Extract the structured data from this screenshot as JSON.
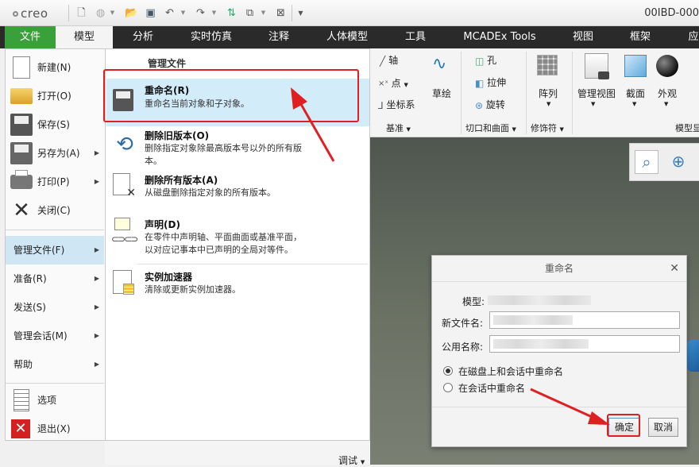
{
  "app": {
    "logo": "creo",
    "window_title": "00IBD-000"
  },
  "ribbon_tabs": [
    "文件",
    "模型",
    "分析",
    "实时仿真",
    "注释",
    "人体模型",
    "工具",
    "MCADEx Tools",
    "视图",
    "框架",
    "应"
  ],
  "ribbon": {
    "datum": {
      "axis": "轴",
      "point": "点",
      "csys": "坐标系",
      "sketch": "草绘",
      "group": "基准"
    },
    "cut_surface": {
      "hole": "孔",
      "extrude": "拉伸",
      "revolve": "旋转",
      "group": "切口和曲面"
    },
    "modifiers": {
      "pattern": "阵列",
      "group": "修饰符"
    },
    "display": {
      "manage_views": "管理视图",
      "section": "截面",
      "appearance": "外观",
      "group": "模型显"
    }
  },
  "file_menu": {
    "items": [
      {
        "label": "新建(N)",
        "icon": "new-file-icon",
        "arrow": false
      },
      {
        "label": "打开(O)",
        "icon": "open-folder-icon",
        "arrow": false
      },
      {
        "label": "保存(S)",
        "icon": "save-disk-icon",
        "arrow": false
      },
      {
        "label": "另存为(A)",
        "icon": "save-as-icon",
        "arrow": true
      },
      {
        "label": "打印(P)",
        "icon": "printer-icon",
        "arrow": true
      },
      {
        "label": "关闭(C)",
        "icon": "close-x-icon",
        "arrow": false
      }
    ],
    "text_items": [
      {
        "label": "管理文件(F)",
        "arrow": true,
        "selected": true
      },
      {
        "label": "准备(R)",
        "arrow": true
      },
      {
        "label": "发送(S)",
        "arrow": true
      },
      {
        "label": "管理会话(M)",
        "arrow": true
      },
      {
        "label": "帮助",
        "arrow": true
      }
    ],
    "bottom_items": [
      {
        "label": "选项",
        "icon": "options-icon"
      },
      {
        "label": "退出(X)",
        "icon": "exit-icon"
      }
    ]
  },
  "submenu": {
    "header": "管理文件",
    "items": [
      {
        "title": "重命名(R)",
        "desc": [
          "重命名当前对象和子对象。"
        ]
      },
      {
        "title": "删除旧版本(O)",
        "desc": [
          "删除指定对象除最高版本号以外的所有版",
          "本。"
        ]
      },
      {
        "title": "删除所有版本(A)",
        "desc": [
          "从磁盘删除指定对象的所有版本。"
        ]
      },
      {
        "title": "声明(D)",
        "desc": [
          "在零件中声明轴、平面曲面或基准平面，",
          "以对应记事本中已声明的全局对等件。"
        ]
      },
      {
        "title": "实例加速器",
        "desc": [
          "清除或更新实例加速器。"
        ]
      }
    ]
  },
  "bottom_bar": {
    "debug": "调试"
  },
  "dialog": {
    "title": "重命名",
    "model_label": "模型:",
    "new_name_label": "新文件名:",
    "common_name_label": "公用名称:",
    "option1": "在磁盘上和会话中重命名",
    "option2": "在会话中重命名",
    "ok": "确定",
    "cancel": "取消"
  },
  "colors": {
    "file_tab": "#3aa03a",
    "highlight": "#d3ecfa",
    "annotation": "#e02020"
  }
}
